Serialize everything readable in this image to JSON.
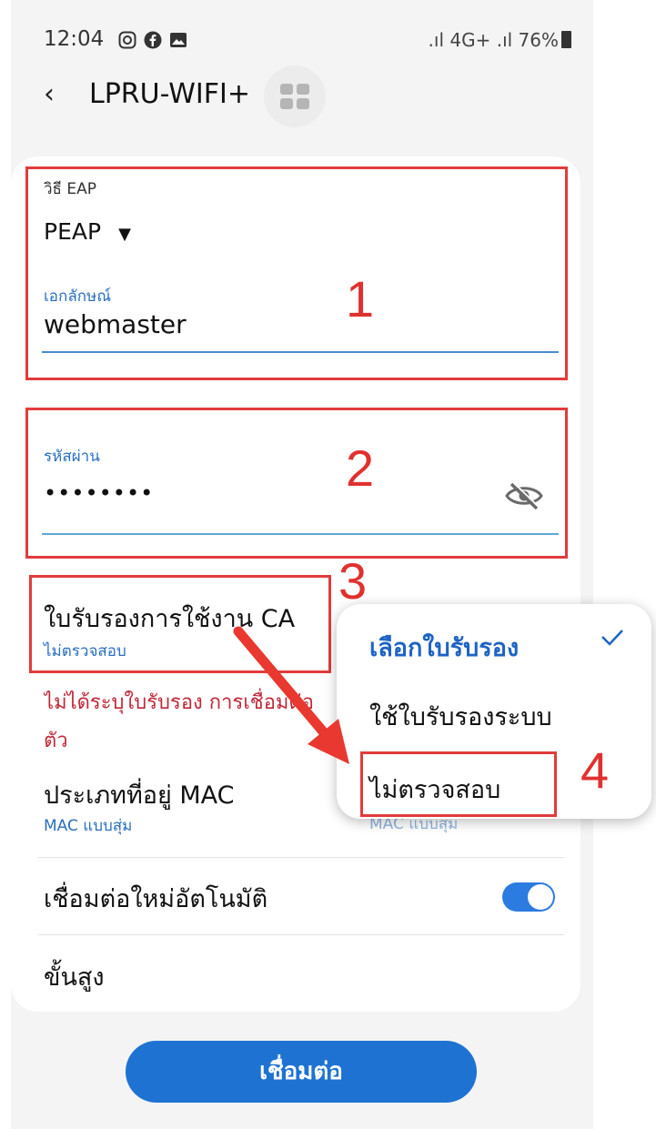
{
  "status_bar": {
    "time": "12:04",
    "right_text": ".ıl 4G+ .ıl 76%",
    "icons": [
      "instagram-icon",
      "facebook-icon",
      "gallery-icon"
    ]
  },
  "header": {
    "back_icon": "‹",
    "title": "LPRU-WIFI+"
  },
  "form": {
    "eap_label": "วิธี EAP",
    "eap_value": "PEAP",
    "identity_label": "เอกลักษณ์",
    "identity_value": "webmaster",
    "password_label": "รหัสผ่าน",
    "password_value": "••••••••",
    "ca_label": "ใบรับรองการใช้งาน CA",
    "ca_value": "ไม่ตรวจสอบ",
    "ca_warning_line1": "ไม่ได้ระบุใบรับรอง การเชื่อมต่อ",
    "ca_warning_line2": "ตัว",
    "mac_label": "ประเภทที่อยู่ MAC",
    "mac_value": "MAC แบบสุ่ม",
    "auto_reconnect_label": "เชื่อมต่อใหม่อัตโนมัติ",
    "auto_reconnect_on": true,
    "advanced_label": "ขั้นสูง"
  },
  "annotations": [
    "1",
    "2",
    "3",
    "4"
  ],
  "popup": {
    "title": "เลือกใบรับรอง",
    "option1": "ใช้ใบรับรองระบบ",
    "option2": "ไม่ตรวจสอบ",
    "behind_text": "MAC แบบสุ่ม"
  },
  "connect_label": "เชื่อมต่อ",
  "colors": {
    "accent": "#1e73d2",
    "annotation_red": "#e33b3b",
    "warning": "#c0283a"
  }
}
